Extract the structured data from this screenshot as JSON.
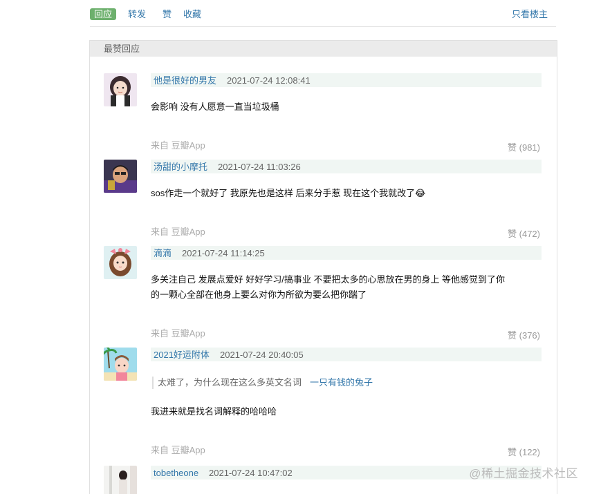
{
  "actions": {
    "reply": "回应",
    "forward": "转发",
    "like": "赞",
    "collect": "收藏",
    "only_op": "只看楼主"
  },
  "panel_title": "最赞回应",
  "comments": [
    {
      "user": "他是很好的男友",
      "time": "2021-07-24 12:08:41",
      "text": "会影响 没有人愿意一直当垃圾桶",
      "source": "来自 豆瓣App",
      "likes": "赞 (981)"
    },
    {
      "user": "汤甜的小摩托",
      "time": "2021-07-24 11:03:26",
      "text": "sos作走一个就好了 我原先也是这样 后来分手惹 现在这个我就改了😂",
      "source": "来自 豆瓣App",
      "likes": "赞 (472)"
    },
    {
      "user": "滴滴",
      "time": "2021-07-24 11:14:25",
      "text_line1": "多关注自己 发展点爱好 好好学习/搞事业 不要把太多的心思放在男的身上 等他感觉到了你",
      "text_line2": "的一颗心全部在他身上要么对你为所欲为要么把你踹了",
      "source": "来自 豆瓣App",
      "likes": "赞 (376)"
    },
    {
      "user": "2021好运附体",
      "time": "2021-07-24 20:40:05",
      "quote": "太难了，为什么现在这么多英文名词",
      "quote_author": "一只有钱的兔子",
      "text": "我进来就是找名词解释的哈哈哈",
      "source": "来自 豆瓣App",
      "likes": "赞 (122)"
    },
    {
      "user": "tobetheone",
      "time": "2021-07-24 10:47:02"
    }
  ],
  "watermark": "@稀土掘金技术社区",
  "colors": {
    "link": "#3377aa",
    "reply_bg": "#6db06d",
    "meta_bg": "#f0f6f3",
    "panel_head_bg": "#ebebeb"
  }
}
